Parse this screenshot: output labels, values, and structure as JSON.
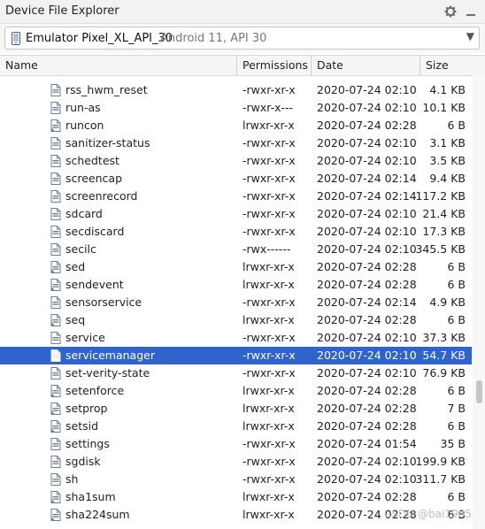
{
  "window": {
    "title": "Device File Explorer",
    "settings_icon": "gear-icon",
    "hide_icon": "minimize-icon"
  },
  "device": {
    "name": "Emulator Pixel_XL_API_30",
    "detail": "Android 11, API 30",
    "icon": "phone-icon"
  },
  "columns": {
    "name": "Name",
    "permissions": "Permissions",
    "date": "Date",
    "size": "Size"
  },
  "files": [
    {
      "name": "rss_hwm_reset",
      "perms": "-rwxr-xr-x",
      "date": "2020-07-24 02:10",
      "size": "4.1 KB",
      "type": "file"
    },
    {
      "name": "run-as",
      "perms": "-rwxr-x---",
      "date": "2020-07-24 02:10",
      "size": "10.1 KB",
      "type": "file"
    },
    {
      "name": "runcon",
      "perms": "lrwxr-xr-x",
      "date": "2020-07-24 02:28",
      "size": "6 B",
      "type": "link"
    },
    {
      "name": "sanitizer-status",
      "perms": "-rwxr-xr-x",
      "date": "2020-07-24 02:10",
      "size": "3.1 KB",
      "type": "file"
    },
    {
      "name": "schedtest",
      "perms": "-rwxr-xr-x",
      "date": "2020-07-24 02:10",
      "size": "3.5 KB",
      "type": "file"
    },
    {
      "name": "screencap",
      "perms": "-rwxr-xr-x",
      "date": "2020-07-24 02:14",
      "size": "9.4 KB",
      "type": "file"
    },
    {
      "name": "screenrecord",
      "perms": "-rwxr-xr-x",
      "date": "2020-07-24 02:14",
      "size": "117.2 KB",
      "type": "file"
    },
    {
      "name": "sdcard",
      "perms": "-rwxr-xr-x",
      "date": "2020-07-24 02:10",
      "size": "21.4 KB",
      "type": "file"
    },
    {
      "name": "secdiscard",
      "perms": "-rwxr-xr-x",
      "date": "2020-07-24 02:10",
      "size": "17.3 KB",
      "type": "file"
    },
    {
      "name": "secilc",
      "perms": "-rwx------",
      "date": "2020-07-24 02:10",
      "size": "345.5 KB",
      "type": "file"
    },
    {
      "name": "sed",
      "perms": "lrwxr-xr-x",
      "date": "2020-07-24 02:28",
      "size": "6 B",
      "type": "link"
    },
    {
      "name": "sendevent",
      "perms": "lrwxr-xr-x",
      "date": "2020-07-24 02:28",
      "size": "6 B",
      "type": "link"
    },
    {
      "name": "sensorservice",
      "perms": "-rwxr-xr-x",
      "date": "2020-07-24 02:14",
      "size": "4.9 KB",
      "type": "file"
    },
    {
      "name": "seq",
      "perms": "lrwxr-xr-x",
      "date": "2020-07-24 02:28",
      "size": "6 B",
      "type": "link"
    },
    {
      "name": "service",
      "perms": "-rwxr-xr-x",
      "date": "2020-07-24 02:10",
      "size": "37.3 KB",
      "type": "file"
    },
    {
      "name": "servicemanager",
      "perms": "-rwxr-xr-x",
      "date": "2020-07-24 02:10",
      "size": "54.7 KB",
      "type": "file",
      "selected": true
    },
    {
      "name": "set-verity-state",
      "perms": "-rwxr-xr-x",
      "date": "2020-07-24 02:10",
      "size": "76.9 KB",
      "type": "file"
    },
    {
      "name": "setenforce",
      "perms": "lrwxr-xr-x",
      "date": "2020-07-24 02:28",
      "size": "6 B",
      "type": "link"
    },
    {
      "name": "setprop",
      "perms": "lrwxr-xr-x",
      "date": "2020-07-24 02:28",
      "size": "7 B",
      "type": "link"
    },
    {
      "name": "setsid",
      "perms": "lrwxr-xr-x",
      "date": "2020-07-24 02:28",
      "size": "6 B",
      "type": "link"
    },
    {
      "name": "settings",
      "perms": "-rwxr-xr-x",
      "date": "2020-07-24 01:54",
      "size": "35 B",
      "type": "file"
    },
    {
      "name": "sgdisk",
      "perms": "-rwxr-xr-x",
      "date": "2020-07-24 02:10",
      "size": "199.9 KB",
      "type": "file"
    },
    {
      "name": "sh",
      "perms": "-rwxr-xr-x",
      "date": "2020-07-24 02:10",
      "size": "311.7 KB",
      "type": "file"
    },
    {
      "name": "sha1sum",
      "perms": "lrwxr-xr-x",
      "date": "2020-07-24 02:28",
      "size": "6 B",
      "type": "link"
    },
    {
      "name": "sha224sum",
      "perms": "lrwxr-xr-x",
      "date": "2020-07-24 02:28",
      "size": "6 B",
      "type": "link"
    }
  ],
  "colors": {
    "selection": "#2f65ca",
    "file_icon": "#6e7f91"
  },
  "watermark": "CSDN @bai1985"
}
